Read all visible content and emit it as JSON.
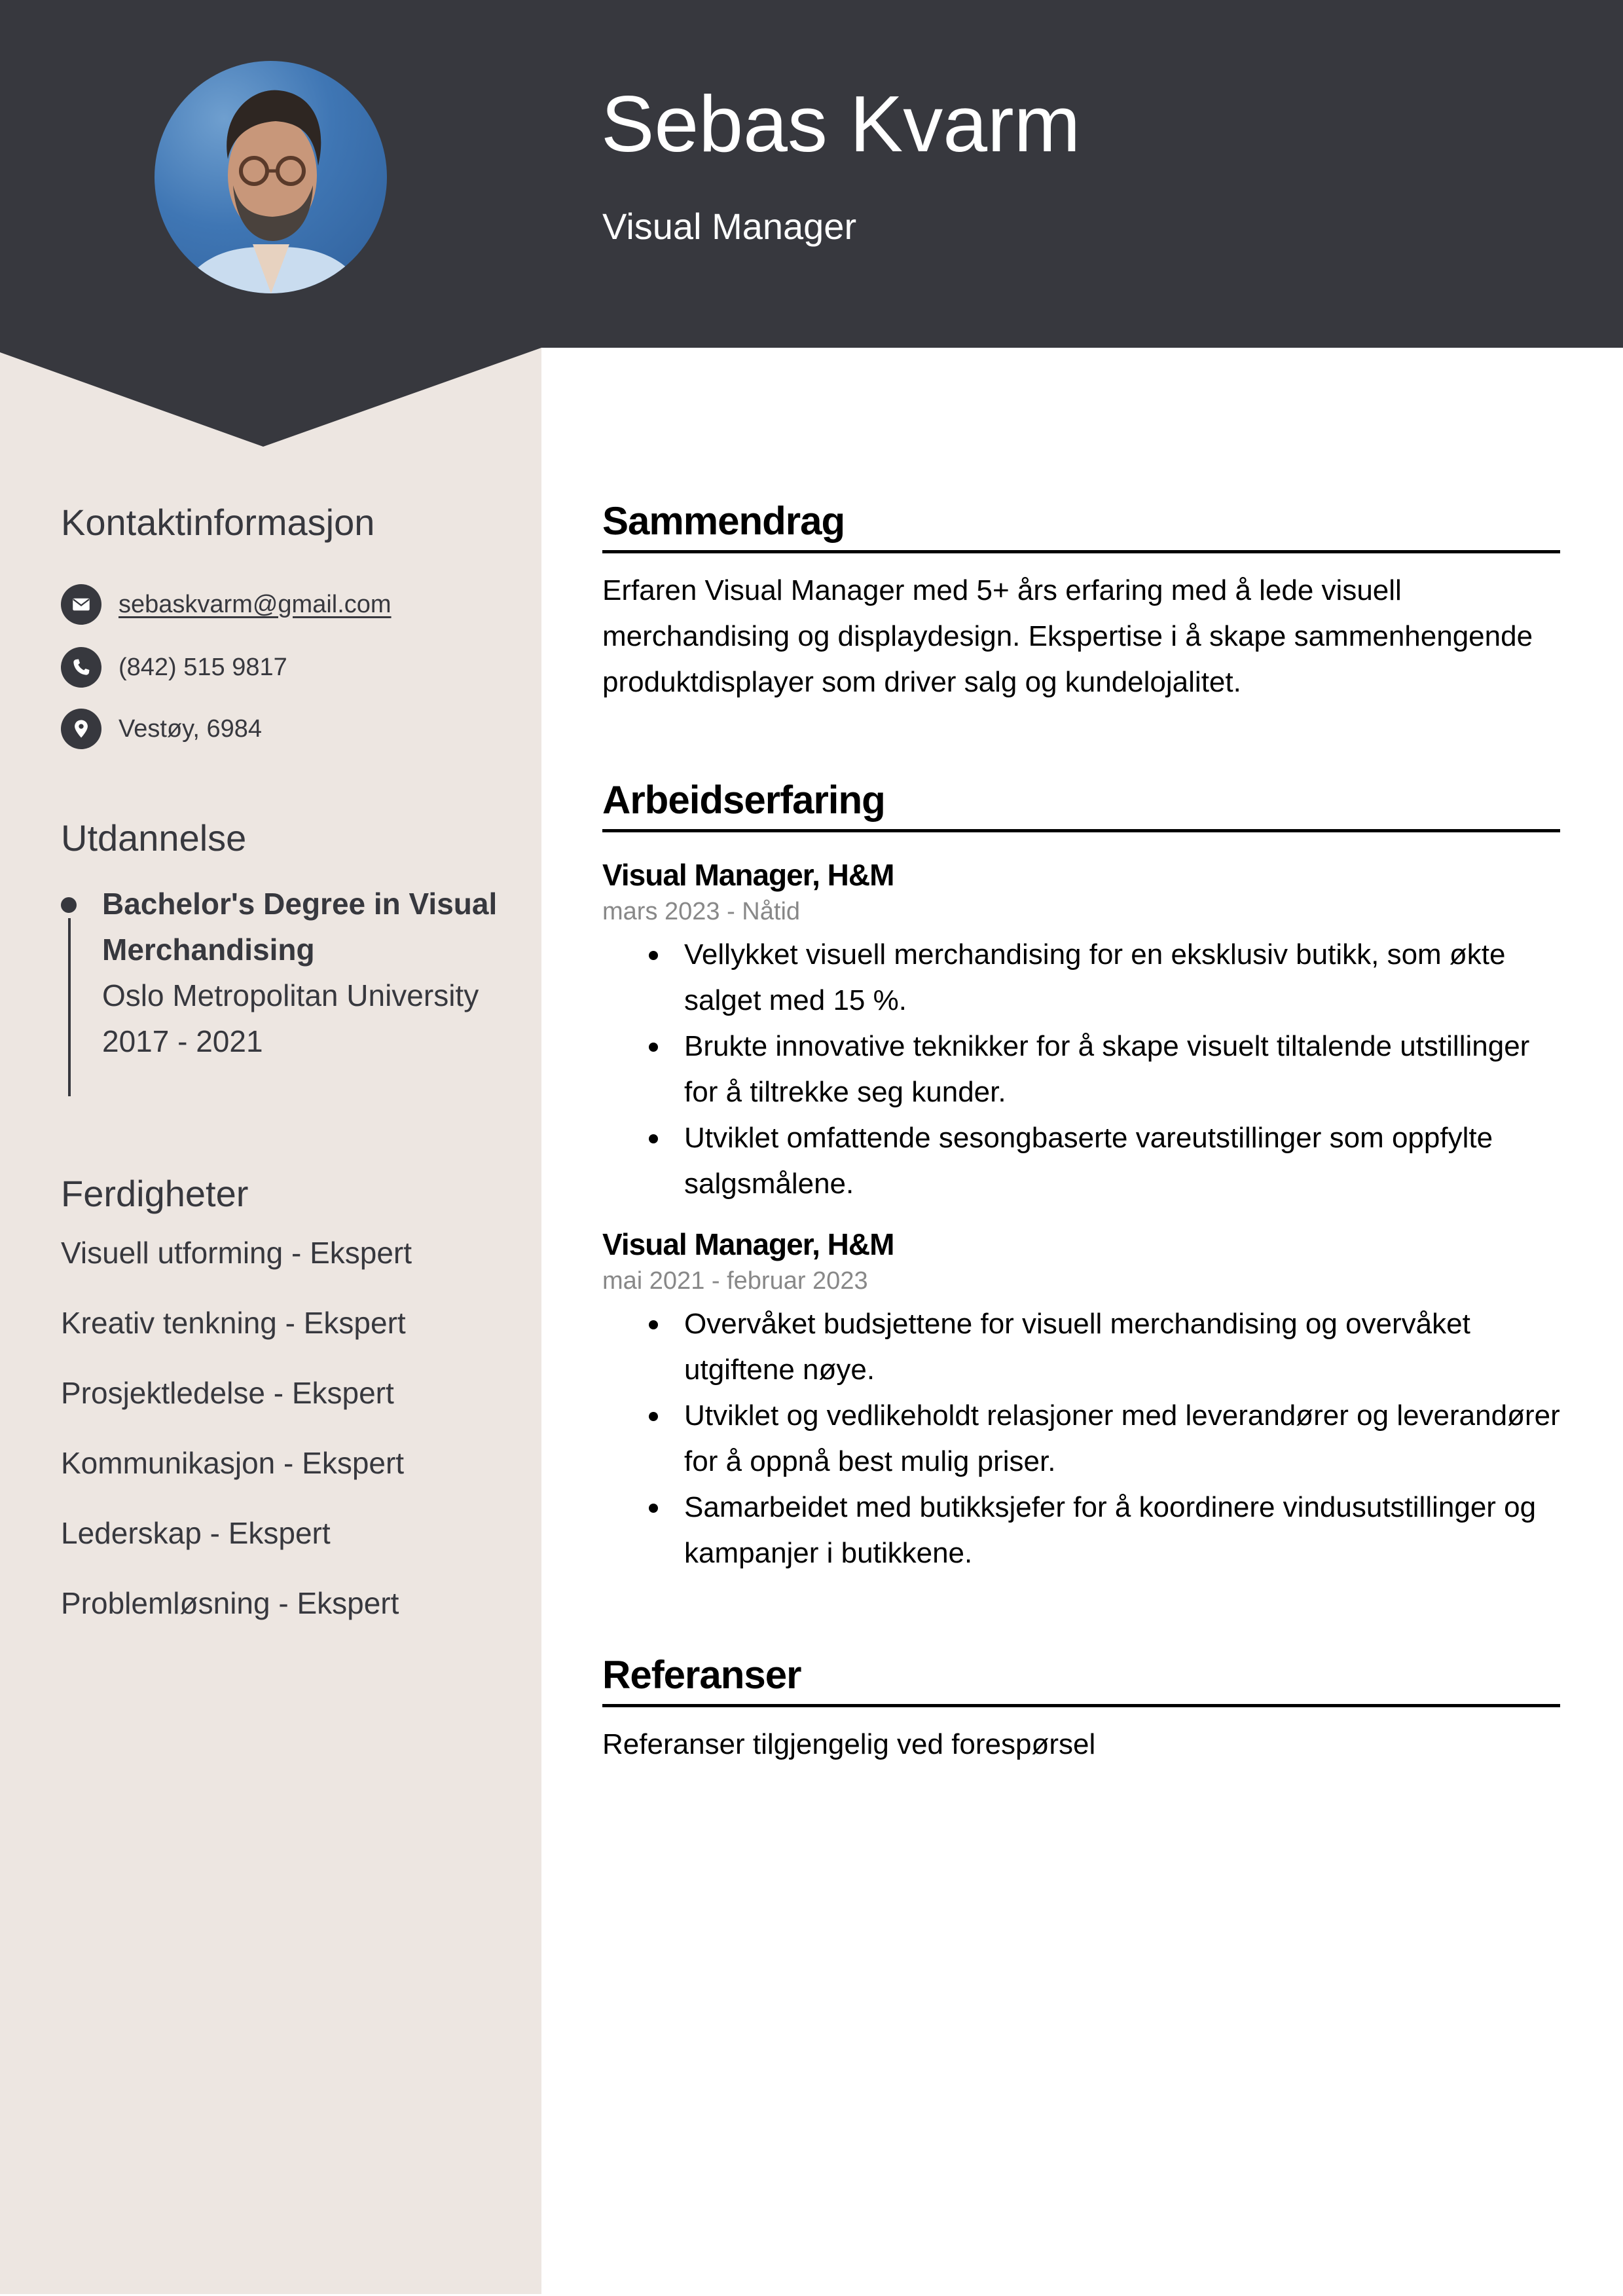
{
  "colors": {
    "header_bg": "#37383e",
    "sidebar_bg": "#ede6e1",
    "text_dark": "#37383e",
    "muted": "#888888"
  },
  "header": {
    "name": "Sebas Kvarm",
    "title": "Visual Manager",
    "photo_alt": "Portrait photo"
  },
  "sidebar": {
    "contact": {
      "heading": "Kontaktinformasjon",
      "items": [
        {
          "icon": "envelope-icon",
          "text": "sebaskvarm@gmail.com"
        },
        {
          "icon": "phone-icon",
          "text": "(842) 515 9817"
        },
        {
          "icon": "location-pin-icon",
          "text": "Vestøy, 6984"
        }
      ]
    },
    "education": {
      "heading": "Utdannelse",
      "items": [
        {
          "degree": "Bachelor's Degree in Visual Merchandising",
          "school": "Oslo Metropolitan University",
          "years": "2017 - 2021"
        }
      ]
    },
    "skills": {
      "heading": "Ferdigheter",
      "items": [
        "Visuell utforming - Ekspert",
        "Kreativ tenkning - Ekspert",
        "Prosjektledelse - Ekspert",
        "Kommunikasjon - Ekspert",
        "Lederskap - Ekspert",
        "Problemløsning - Ekspert"
      ]
    }
  },
  "main": {
    "summary": {
      "heading": "Sammendrag",
      "text": "Erfaren Visual Manager med 5+ års erfaring med å lede visuell merchandising og displaydesign. Ekspertise i å skape sammenhengende produktdisplayer som driver salg og kundelojalitet."
    },
    "experience": {
      "heading": "Arbeidserfaring",
      "jobs": [
        {
          "title": "Visual Manager, H&M",
          "dates": "mars 2023 - Nåtid",
          "bullets": [
            "Vellykket visuell merchandising for en eksklusiv butikk, som økte salget med 15 %.",
            "Brukte innovative teknikker for å skape visuelt tiltalende utstillinger for å tiltrekke seg kunder.",
            "Utviklet omfattende sesongbaserte vareutstillinger som oppfylte salgsmålene."
          ]
        },
        {
          "title": "Visual Manager, H&M",
          "dates": "mai 2021 - februar 2023",
          "bullets": [
            "Overvåket budsjettene for visuell merchandising og overvåket utgiftene nøye.",
            "Utviklet og vedlikeholdt relasjoner med leverandører og leverandører for å oppnå best mulig priser.",
            "Samarbeidet med butikksjefer for å koordinere vindusutstillinger og kampanjer i butikkene."
          ]
        }
      ]
    },
    "references": {
      "heading": "Referanser",
      "text": "Referanser tilgjengelig ved forespørsel"
    }
  }
}
